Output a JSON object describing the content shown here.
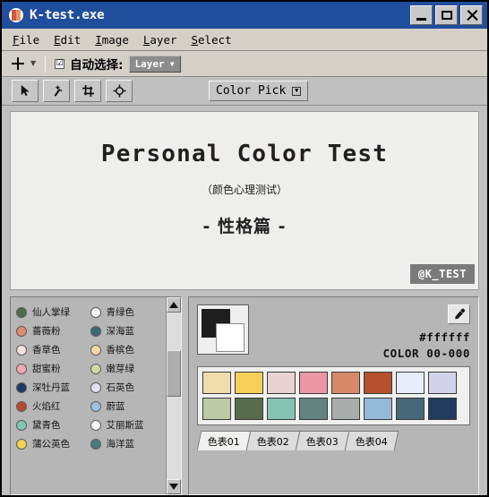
{
  "window": {
    "title": "K-test.exe",
    "app_icon": "k-badge-icon",
    "controls": {
      "minimize": "minimize-icon",
      "maximize": "maximize-icon",
      "close": "close-icon"
    }
  },
  "menubar": {
    "items": [
      {
        "label": "File",
        "mnemonic": "F"
      },
      {
        "label": "Edit",
        "mnemonic": "E"
      },
      {
        "label": "Image",
        "mnemonic": "I"
      },
      {
        "label": "Layer",
        "mnemonic": "L"
      },
      {
        "label": "Select",
        "mnemonic": "S"
      }
    ]
  },
  "options_bar": {
    "tool_icon": "move-tool-icon",
    "caret": "chevron-down-icon",
    "checkbox_checked": "☑",
    "checkbox_label": "自动选择:",
    "dropdown_value": "Layer",
    "dropdown_caret": "chevron-down-icon"
  },
  "toolbar": {
    "tools": [
      {
        "name": "pointer-tool",
        "icon": "cursor-arrow-icon"
      },
      {
        "name": "magic-wand-tool",
        "icon": "magic-wand-icon"
      },
      {
        "name": "crop-tool",
        "icon": "crop-icon"
      },
      {
        "name": "target-tool",
        "icon": "target-crosshair-icon"
      }
    ],
    "mode_dropdown": {
      "label": "Color Pick",
      "caret": "chevron-down-icon"
    }
  },
  "canvas": {
    "title": "Personal Color Test",
    "subtitle": "（颜色心理测试）",
    "section": "- 性格篇 -",
    "watermark": "@K_TEST",
    "background": "#eeeeec"
  },
  "color_list": {
    "items": [
      {
        "name": "仙人掌绿",
        "color": "#4d6b4d"
      },
      {
        "name": "青绿色",
        "color": "#f7f9f6"
      },
      {
        "name": "蔷薇粉",
        "color": "#e08a6e"
      },
      {
        "name": "深海蓝",
        "color": "#3d6878"
      },
      {
        "name": "香草色",
        "color": "#f6e3e0"
      },
      {
        "name": "香槟色",
        "color": "#f6dba8"
      },
      {
        "name": "甜蜜粉",
        "color": "#f2a7b4"
      },
      {
        "name": "嫩芽绿",
        "color": "#cadb9c"
      },
      {
        "name": "深牡丹蓝",
        "color": "#1d3a63"
      },
      {
        "name": "石英色",
        "color": "#e3e0ef"
      },
      {
        "name": "火焰红",
        "color": "#b9492b"
      },
      {
        "name": "蔚蓝",
        "color": "#9cc0de"
      },
      {
        "name": "黛青色",
        "color": "#7ec7b4"
      },
      {
        "name": "艾丽斯蓝",
        "color": "#f6fbff"
      },
      {
        "name": "蒲公英色",
        "color": "#f6d257"
      },
      {
        "name": "海洋蓝",
        "color": "#4c7b7d"
      }
    ],
    "scrollbar": {
      "up_arrow": "triangle-up-icon",
      "down_arrow": "triangle-down-icon"
    }
  },
  "swatch_panel": {
    "foreground_color": "#1e1e1e",
    "background_color": "#ffffff",
    "eyedropper_icon": "eyedropper-icon",
    "hex_value": "#ffffff",
    "color_code": "COLOR 00-000",
    "swatches": [
      [
        "#f0dbad",
        "#f6cf58",
        "#e8d2d2",
        "#eb96a4",
        "#d78a6a",
        "#b4512f",
        "#e6ecfa",
        "#d2d2ea"
      ],
      [
        "#bdcba5",
        "#576c4d",
        "#84c2b2",
        "#628481",
        "#a8adab",
        "#96b9d9",
        "#466879",
        "#1f3b5e"
      ]
    ],
    "tabs": [
      {
        "label": "色表01",
        "active": true
      },
      {
        "label": "色表02",
        "active": false
      },
      {
        "label": "色表03",
        "active": false
      },
      {
        "label": "色表04",
        "active": false
      }
    ]
  }
}
